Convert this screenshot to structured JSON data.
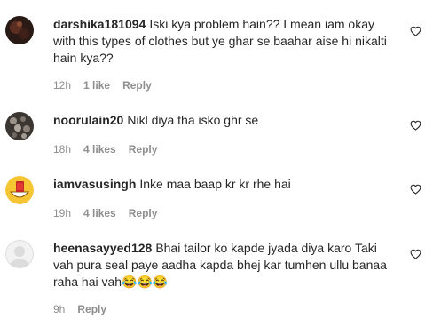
{
  "comments": [
    {
      "username": "darshika181094",
      "text": "Iski kya problem hain?? I mean iam okay with this types of clothes but ye ghar se baahar aise hi nikalti hain kya??",
      "time": "12h",
      "likes": "1 like",
      "reply": "Reply",
      "avatar": "dark-circle-avatar"
    },
    {
      "username": "noorulain20",
      "text": "Nikl diya tha isko ghr se",
      "time": "18h",
      "likes": "4 likes",
      "reply": "Reply",
      "avatar": "photo-avatar"
    },
    {
      "username": "iamvasusingh",
      "text": "Inke maa baap kr kr rhe hai",
      "time": "19h",
      "likes": "4 likes",
      "reply": "Reply",
      "avatar": "emoji-avatar"
    },
    {
      "username": "heenasayyed128",
      "text": "Bhai tailor ko kapde jyada diya karo Taki vah pura seal paye aadha kapda bhej kar tumhen ullu banaa raha hai vah😂😂😂",
      "time": "9h",
      "likes": "",
      "reply": "Reply",
      "avatar": "default-avatar"
    }
  ],
  "colors": {
    "text": "#262626",
    "meta": "#8e8e8e"
  },
  "icons": {
    "like": "heart-outline-icon"
  }
}
